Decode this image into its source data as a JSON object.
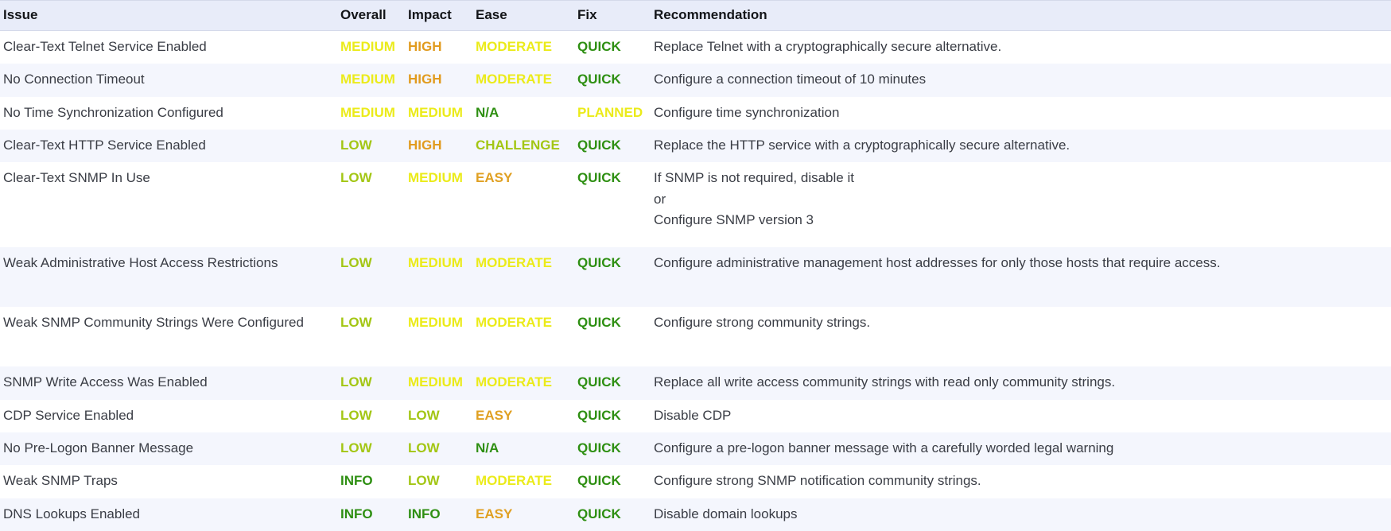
{
  "table": {
    "name": "security-issue-findings-table",
    "columns": [
      {
        "key": "issue",
        "label": "Issue"
      },
      {
        "key": "overall",
        "label": "Overall"
      },
      {
        "key": "impact",
        "label": "Impact"
      },
      {
        "key": "ease",
        "label": "Ease"
      },
      {
        "key": "fix",
        "label": "Fix"
      },
      {
        "key": "recommendation",
        "label": "Recommendation"
      }
    ],
    "rows": [
      {
        "issue": "Clear-Text Telnet Service Enabled",
        "overall": "MEDIUM",
        "impact": "HIGH",
        "ease": "MODERATE",
        "fix": "QUICK",
        "recommendation": "Replace Telnet with a cryptographically secure alternative."
      },
      {
        "issue": "No Connection Timeout",
        "overall": "MEDIUM",
        "impact": "HIGH",
        "ease": "MODERATE",
        "fix": "QUICK",
        "recommendation": "Configure a connection timeout of 10 minutes"
      },
      {
        "issue": "No Time Synchronization Configured",
        "overall": "MEDIUM",
        "impact": "MEDIUM",
        "ease": "N/A",
        "fix": "PLANNED",
        "recommendation": "Configure time synchronization"
      },
      {
        "issue": "Clear-Text HTTP Service Enabled",
        "overall": "LOW",
        "impact": "HIGH",
        "ease": "CHALLENGE",
        "fix": "QUICK",
        "recommendation": "Replace the HTTP service with a cryptographically secure alternative."
      },
      {
        "issue": "Clear-Text SNMP In Use",
        "overall": "LOW",
        "impact": "MEDIUM",
        "ease": "EASY",
        "fix": "QUICK",
        "recommendation": "If SNMP is not required, disable it\nor\nConfigure SNMP version 3"
      },
      {
        "issue": "Weak Administrative Host Access Restrictions",
        "overall": "LOW",
        "impact": "MEDIUM",
        "ease": "MODERATE",
        "fix": "QUICK",
        "recommendation": "Configure administrative management host addresses for only those hosts that require access."
      },
      {
        "issue": "Weak SNMP Community Strings Were Configured",
        "overall": "LOW",
        "impact": "MEDIUM",
        "ease": "MODERATE",
        "fix": "QUICK",
        "recommendation": "Configure strong community strings."
      },
      {
        "issue": "SNMP Write Access Was Enabled",
        "overall": "LOW",
        "impact": "MEDIUM",
        "ease": "MODERATE",
        "fix": "QUICK",
        "recommendation": "Replace all write access community strings with read only community strings."
      },
      {
        "issue": "CDP Service Enabled",
        "overall": "LOW",
        "impact": "LOW",
        "ease": "EASY",
        "fix": "QUICK",
        "recommendation": "Disable CDP"
      },
      {
        "issue": "No Pre-Logon Banner Message",
        "overall": "LOW",
        "impact": "LOW",
        "ease": "N/A",
        "fix": "QUICK",
        "recommendation": "Configure a pre-logon banner message with a carefully worded legal warning"
      },
      {
        "issue": "Weak SNMP Traps",
        "overall": "INFO",
        "impact": "LOW",
        "ease": "MODERATE",
        "fix": "QUICK",
        "recommendation": "Configure strong SNMP notification community strings."
      },
      {
        "issue": "DNS Lookups Enabled",
        "overall": "INFO",
        "impact": "INFO",
        "ease": "EASY",
        "fix": "QUICK",
        "recommendation": "Disable domain lookups"
      }
    ],
    "row_heights": [
      1,
      1,
      1,
      1,
      3,
      2,
      2,
      1,
      1,
      1,
      1,
      1
    ],
    "colors": {
      "header_background": "#e8ecf9",
      "row_stripe_background": "#f4f6fd",
      "row_background": "#ffffff",
      "body_text": "#3a3d45",
      "header_text": "#131519",
      "HIGH": "#e19b1e",
      "MEDIUM": "#ebeb1a",
      "LOW": "#a3c614",
      "INFO": "#2e8f12",
      "N/A": "#2e8f12",
      "EASY": "#e0a022",
      "MODERATE": "#ebeb1a",
      "CHALLENGE": "#a3c614",
      "QUICK": "#2e8f12",
      "PLANNED": "#ebeb1a"
    }
  }
}
